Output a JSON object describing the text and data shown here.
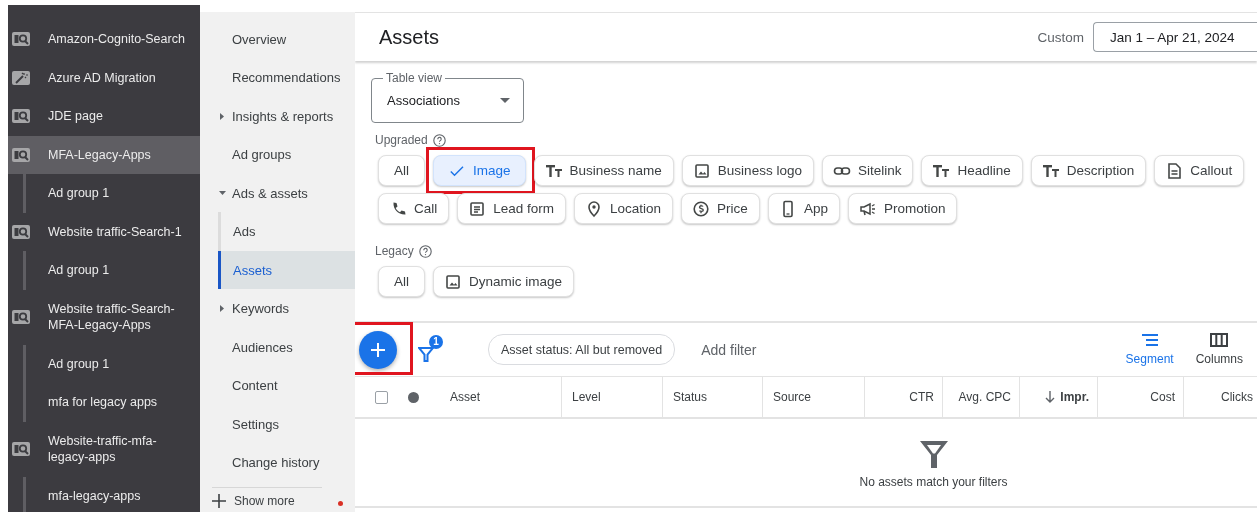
{
  "campaigns": [
    {
      "label": "Amazon-Cognito-Search",
      "kind": "search",
      "selected": false
    },
    {
      "label": "Azure AD Migration",
      "kind": "smart",
      "selected": false
    },
    {
      "label": "JDE page",
      "kind": "search",
      "selected": false
    },
    {
      "label": "MFA-Legacy-Apps",
      "kind": "search",
      "selected": true,
      "children": [
        {
          "label": "Ad group 1",
          "selected": false
        }
      ]
    },
    {
      "label": "Website traffic-Search-1",
      "kind": "search",
      "selected": false,
      "children": [
        {
          "label": "Ad group 1",
          "selected": false
        }
      ]
    },
    {
      "label": "Website traffic-Search-MFA-Legacy-Apps",
      "kind": "search",
      "selected": false,
      "children": [
        {
          "label": "Ad group 1",
          "selected": false
        },
        {
          "label": "mfa for legacy apps",
          "selected": false
        }
      ]
    },
    {
      "label": "Website-traffic-mfa-legacy-apps",
      "kind": "search",
      "selected": false,
      "children": [
        {
          "label": "mfa-legacy-apps",
          "selected": false
        }
      ]
    }
  ],
  "nav": {
    "items": [
      {
        "label": "Overview",
        "selected": false
      },
      {
        "label": "Recommendations",
        "selected": false
      },
      {
        "label": "Insights & reports",
        "selected": false,
        "expanded": false
      },
      {
        "label": "Ad groups",
        "selected": false
      },
      {
        "label": "Ads & assets",
        "selected": false,
        "expanded": true,
        "children": [
          {
            "label": "Ads",
            "selected": false
          },
          {
            "label": "Assets",
            "selected": true
          }
        ]
      },
      {
        "label": "Keywords",
        "selected": false,
        "expanded": false
      },
      {
        "label": "Audiences",
        "selected": false
      },
      {
        "label": "Content",
        "selected": false
      },
      {
        "label": "Settings",
        "selected": false
      },
      {
        "label": "Change history",
        "selected": false
      }
    ],
    "show_more": {
      "label": "Show more",
      "notification": true
    }
  },
  "page": {
    "title": "Assets",
    "date_range": {
      "preset": "Custom",
      "value": "Jan 1 – Apr 21, 2024"
    }
  },
  "table_view": {
    "label": "Table view",
    "value": "Associations"
  },
  "groups": [
    {
      "label": "Upgraded",
      "rows": [
        [
          {
            "label": "All",
            "kind": "all",
            "selected": false,
            "highlighted": false
          },
          {
            "label": "Image",
            "kind": "image",
            "selected": true,
            "highlighted": true
          },
          {
            "label": "Business name",
            "kind": "text",
            "selected": false,
            "highlighted": false
          },
          {
            "label": "Business logo",
            "kind": "image",
            "selected": false,
            "highlighted": false
          },
          {
            "label": "Sitelink",
            "kind": "link",
            "selected": false,
            "highlighted": false
          },
          {
            "label": "Headline",
            "kind": "text",
            "selected": false,
            "highlighted": false
          },
          {
            "label": "Description",
            "kind": "text",
            "selected": false,
            "highlighted": false
          },
          {
            "label": "Callout",
            "kind": "callout",
            "selected": false,
            "highlighted": false
          }
        ],
        [
          {
            "label": "Call",
            "kind": "call",
            "selected": false,
            "highlighted": false
          },
          {
            "label": "Lead form",
            "kind": "form",
            "selected": false,
            "highlighted": false
          },
          {
            "label": "Location",
            "kind": "location",
            "selected": false,
            "highlighted": false
          },
          {
            "label": "Price",
            "kind": "price",
            "selected": false,
            "highlighted": false
          },
          {
            "label": "App",
            "kind": "app",
            "selected": false,
            "highlighted": false
          },
          {
            "label": "Promotion",
            "kind": "promotion",
            "selected": false,
            "highlighted": false
          }
        ]
      ]
    },
    {
      "label": "Legacy",
      "rows": [
        [
          {
            "label": "All",
            "kind": "all",
            "selected": false,
            "highlighted": false
          },
          {
            "label": "Dynamic image",
            "kind": "image",
            "selected": false,
            "highlighted": false
          }
        ]
      ]
    }
  ],
  "toolbar": {
    "add_button": {
      "highlighted": true
    },
    "filter_count": "1",
    "status_filter": "Asset status: All but removed",
    "add_filter": "Add filter",
    "tools": [
      {
        "label": "Segment",
        "kind": "segment",
        "active": true
      },
      {
        "label": "Columns",
        "kind": "columns",
        "active": false
      }
    ]
  },
  "table": {
    "select_all": {
      "checked": false
    },
    "columns": [
      {
        "label": "Asset",
        "kind": "attribute"
      },
      {
        "label": "Level",
        "kind": "attribute"
      },
      {
        "label": "Status",
        "kind": "attribute"
      },
      {
        "label": "Source",
        "kind": "attribute"
      },
      {
        "label": "CTR",
        "kind": "metric"
      },
      {
        "label": "Avg. CPC",
        "kind": "metric"
      },
      {
        "label": "Impr.",
        "kind": "metric",
        "sort_descending": true
      },
      {
        "label": "Cost",
        "kind": "metric"
      },
      {
        "label": "Clicks",
        "kind": "metric"
      }
    ],
    "empty_message": "No assets match your filters"
  }
}
